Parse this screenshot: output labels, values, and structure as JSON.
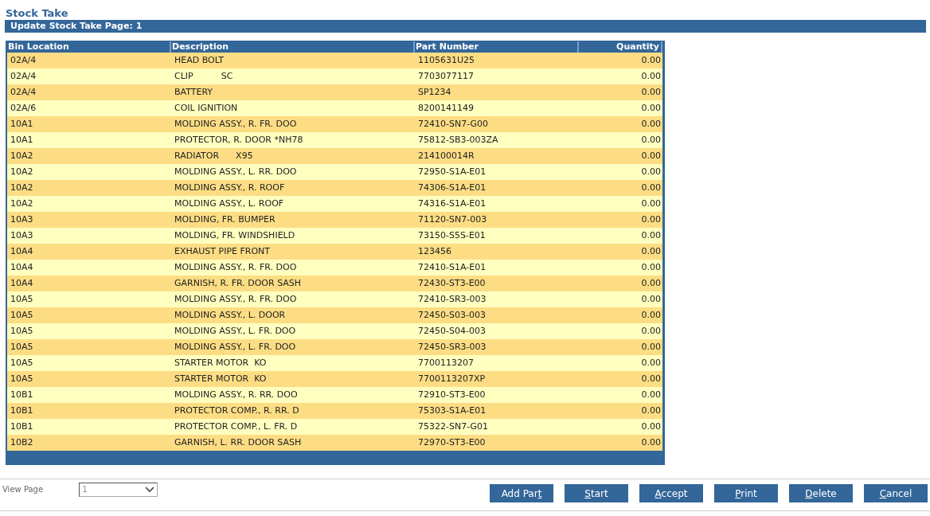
{
  "page_title": "Stock Take",
  "section_title": "Update Stock Take Page: 1",
  "table": {
    "columns": [
      "Bin Location",
      "Description",
      "Part Number",
      "Quantity"
    ],
    "rows": [
      [
        "02A/4",
        "HEAD BOLT",
        "1105631U25",
        "0.00"
      ],
      [
        "02A/4",
        "CLIP          SC",
        "7703077117",
        "0.00"
      ],
      [
        "02A/4",
        "BATTERY",
        "SP1234",
        "0.00"
      ],
      [
        "02A/6",
        "COIL IGNITION",
        "8200141149",
        "0.00"
      ],
      [
        "10A1",
        "MOLDING ASSY., R. FR. DOO",
        "72410-SN7-G00",
        "0.00"
      ],
      [
        "10A1",
        "PROTECTOR, R. DOOR *NH78",
        "75812-SB3-003ZA",
        "0.00"
      ],
      [
        "10A2",
        "RADIATOR      X95",
        "214100014R",
        "0.00"
      ],
      [
        "10A2",
        "MOLDING ASSY., L. RR. DOO",
        "72950-S1A-E01",
        "0.00"
      ],
      [
        "10A2",
        "MOLDING ASSY., R. ROOF",
        "74306-S1A-E01",
        "0.00"
      ],
      [
        "10A2",
        "MOLDING ASSY., L. ROOF",
        "74316-S1A-E01",
        "0.00"
      ],
      [
        "10A3",
        "MOLDING, FR. BUMPER",
        "71120-SN7-003",
        "0.00"
      ],
      [
        "10A3",
        "MOLDING, FR. WINDSHIELD",
        "73150-S5S-E01",
        "0.00"
      ],
      [
        "10A4",
        "EXHAUST PIPE FRONT",
        "123456",
        "0.00"
      ],
      [
        "10A4",
        "MOLDING ASSY., R. FR. DOO",
        "72410-S1A-E01",
        "0.00"
      ],
      [
        "10A4",
        "GARNISH, R. FR. DOOR SASH",
        "72430-ST3-E00",
        "0.00"
      ],
      [
        "10A5",
        "MOLDING ASSY., R. FR. DOO",
        "72410-SR3-003",
        "0.00"
      ],
      [
        "10A5",
        "MOLDING ASSY., L. DOOR",
        "72450-S03-003",
        "0.00"
      ],
      [
        "10A5",
        "MOLDING ASSY., L. FR. DOO",
        "72450-S04-003",
        "0.00"
      ],
      [
        "10A5",
        "MOLDING ASSY., L. FR. DOO",
        "72450-SR3-003",
        "0.00"
      ],
      [
        "10A5",
        "STARTER MOTOR  KO",
        "7700113207",
        "0.00"
      ],
      [
        "10A5",
        "STARTER MOTOR  KO",
        "7700113207XP",
        "0.00"
      ],
      [
        "10B1",
        "MOLDING ASSY., R. RR. DOO",
        "72910-ST3-E00",
        "0.00"
      ],
      [
        "10B1",
        "PROTECTOR COMP., R. RR. D",
        "75303-S1A-E01",
        "0.00"
      ],
      [
        "10B1",
        "PROTECTOR COMP., L. FR. D",
        "75322-SN7-G01",
        "0.00"
      ],
      [
        "10B2",
        "GARNISH, L. RR. DOOR SASH",
        "72970-ST3-E00",
        "0.00"
      ]
    ]
  },
  "view_page": {
    "label": "View Page",
    "value": "1",
    "disabled": true
  },
  "buttons": [
    {
      "before": "Add Par",
      "key": "t"
    },
    {
      "key": "S",
      "after": "tart"
    },
    {
      "key": "A",
      "after": "ccept"
    },
    {
      "key": "P",
      "after": "rint"
    },
    {
      "key": "D",
      "after": "elete"
    },
    {
      "key": "C",
      "after": "ancel"
    }
  ]
}
